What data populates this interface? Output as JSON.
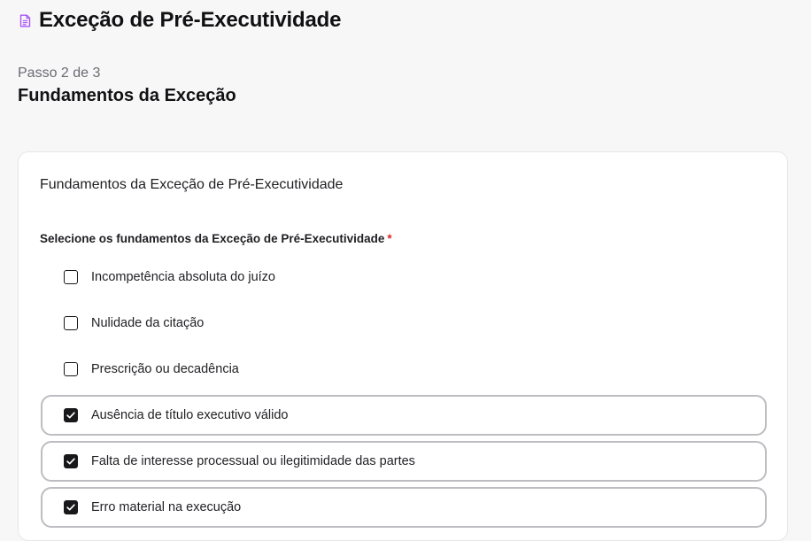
{
  "header": {
    "icon": "document-icon",
    "title": "Exceção de Pré-Executividade"
  },
  "step": {
    "label": "Passo 2 de 3",
    "title": "Fundamentos da Exceção"
  },
  "card": {
    "title": "Fundamentos da Exceção de Pré-Executividade",
    "field_label": "Selecione os fundamentos da Exceção de Pré-Executividade",
    "required_mark": "*",
    "options": [
      {
        "label": "Incompetência absoluta do juízo",
        "checked": false
      },
      {
        "label": "Nulidade da citação",
        "checked": false
      },
      {
        "label": "Prescrição ou decadência",
        "checked": false
      },
      {
        "label": "Ausência de título executivo válido",
        "checked": true
      },
      {
        "label": "Falta de interesse processual ou ilegitimidade das partes",
        "checked": true
      },
      {
        "label": "Erro material na execução",
        "checked": true
      }
    ]
  },
  "colors": {
    "accent_icon": "#a855f7",
    "selected_border": "#bdbdc2",
    "required": "#dc2626"
  }
}
